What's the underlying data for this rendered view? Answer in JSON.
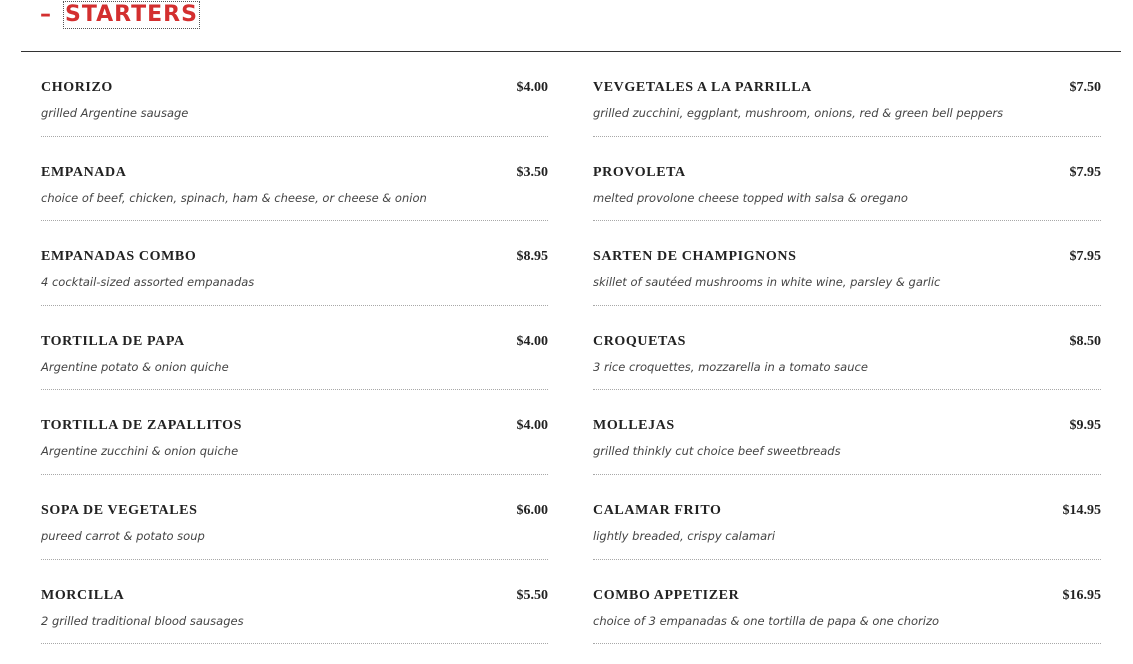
{
  "section": {
    "toggle": "–",
    "title": "STARTERS"
  },
  "menu": {
    "left": [
      {
        "name": "CHORIZO",
        "price": "$4.00",
        "desc": "grilled Argentine sausage"
      },
      {
        "name": "EMPANADA",
        "price": "$3.50",
        "desc": "choice of beef, chicken, spinach, ham & cheese, or cheese & onion"
      },
      {
        "name": "EMPANADAS COMBO",
        "price": "$8.95",
        "desc": "4 cocktail-sized assorted empanadas"
      },
      {
        "name": "TORTILLA DE PAPA",
        "price": "$4.00",
        "desc": "Argentine potato & onion quiche"
      },
      {
        "name": "TORTILLA DE ZAPALLITOS",
        "price": "$4.00",
        "desc": "Argentine zucchini & onion quiche"
      },
      {
        "name": "SOPA DE VEGETALES",
        "price": "$6.00",
        "desc": "pureed carrot & potato soup"
      },
      {
        "name": "MORCILLA",
        "price": "$5.50",
        "desc": "2 grilled traditional blood sausages"
      }
    ],
    "right": [
      {
        "name": "VEVGETALES A LA PARRILLA",
        "price": "$7.50",
        "desc": "grilled zucchini, eggplant, mushroom, onions, red & green bell peppers"
      },
      {
        "name": "PROVOLETA",
        "price": "$7.95",
        "desc": "melted provolone cheese topped with salsa & oregano"
      },
      {
        "name": "SARTEN DE CHAMPIGNONS",
        "price": "$7.95",
        "desc": "skillet of sautéed mushrooms in white wine, parsley & garlic"
      },
      {
        "name": "CROQUETAS",
        "price": "$8.50",
        "desc": "3 rice croquettes, mozzarella in a tomato sauce"
      },
      {
        "name": "MOLLEJAS",
        "price": "$9.95",
        "desc": "grilled thinkly cut choice beef sweetbreads"
      },
      {
        "name": "CALAMAR FRITO",
        "price": "$14.95",
        "desc": "lightly breaded, crispy calamari"
      },
      {
        "name": "COMBO APPETIZER",
        "price": "$16.95",
        "desc": "choice of 3 empanadas & one tortilla de papa & one chorizo"
      }
    ]
  },
  "colors": {
    "accent": "#d32f2f",
    "text": "#222222",
    "muted": "#444444"
  }
}
